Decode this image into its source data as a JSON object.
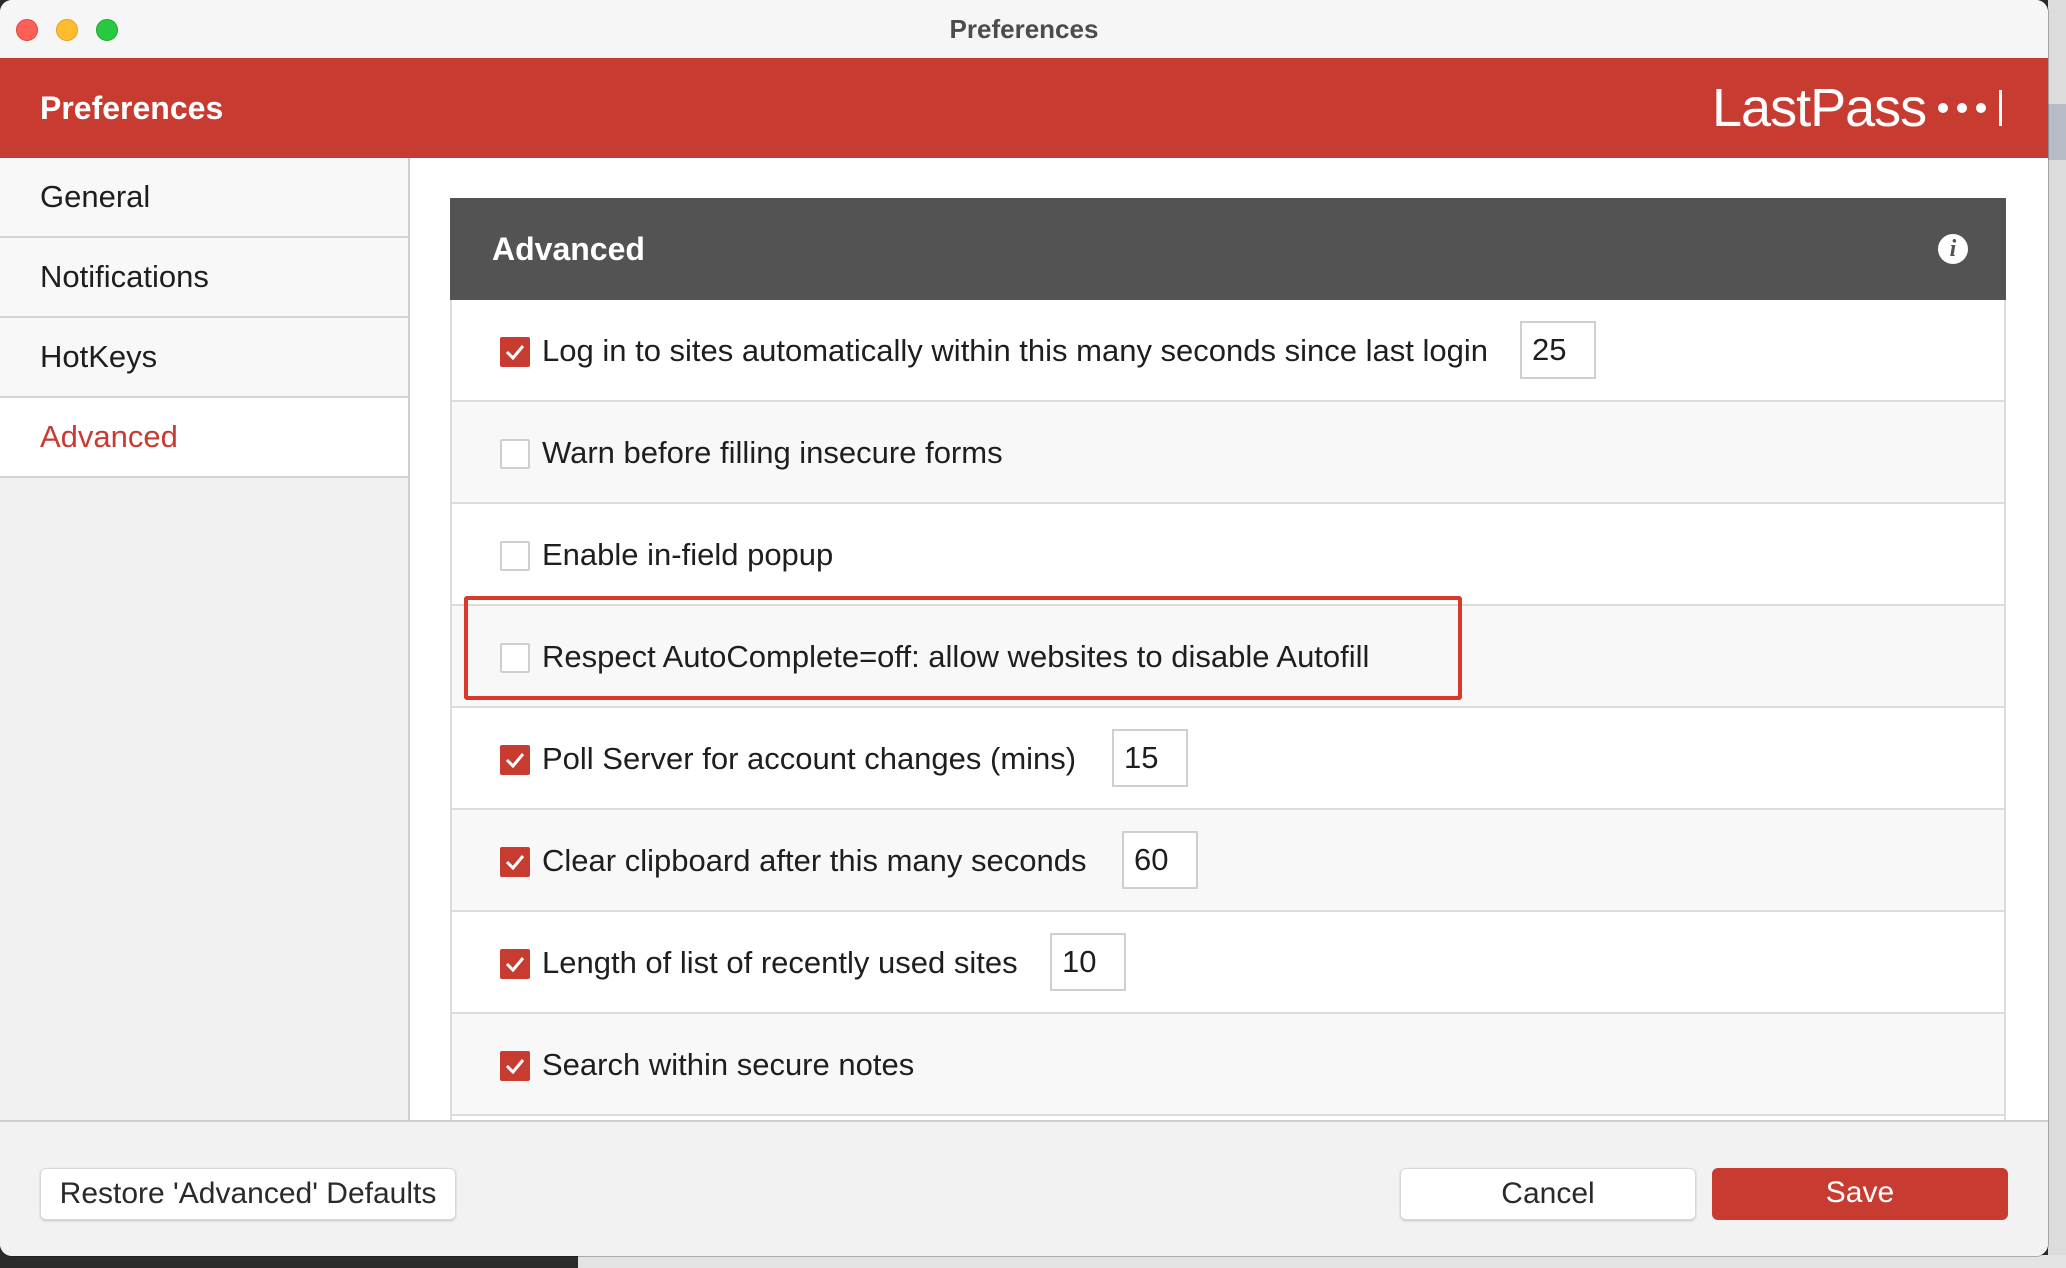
{
  "window": {
    "title": "Preferences"
  },
  "header": {
    "title": "Preferences",
    "logo_text": "LastPass",
    "accent_color": "#c83b31"
  },
  "sidebar": {
    "items": [
      {
        "label": "General",
        "active": false
      },
      {
        "label": "Notifications",
        "active": false
      },
      {
        "label": "HotKeys",
        "active": false
      },
      {
        "label": "Advanced",
        "active": true
      }
    ]
  },
  "panel": {
    "title": "Advanced",
    "info_icon": "info-icon",
    "settings": [
      {
        "label": "Log in to sites automatically within this many seconds since last login",
        "checked": true,
        "value": "25"
      },
      {
        "label": "Warn before filling insecure forms",
        "checked": false
      },
      {
        "label": "Enable in-field popup",
        "checked": false
      },
      {
        "label": "Respect AutoComplete=off: allow websites to disable Autofill",
        "checked": false,
        "highlighted": true
      },
      {
        "label": "Poll Server for account changes (mins)",
        "checked": true,
        "value": "15"
      },
      {
        "label": "Clear clipboard after this many seconds",
        "checked": true,
        "value": "60"
      },
      {
        "label": "Length of list of recently used sites",
        "checked": true,
        "value": "10"
      },
      {
        "label": "Search within secure notes",
        "checked": true
      }
    ]
  },
  "footer": {
    "restore_label": "Restore 'Advanced' Defaults",
    "cancel_label": "Cancel",
    "save_label": "Save"
  }
}
